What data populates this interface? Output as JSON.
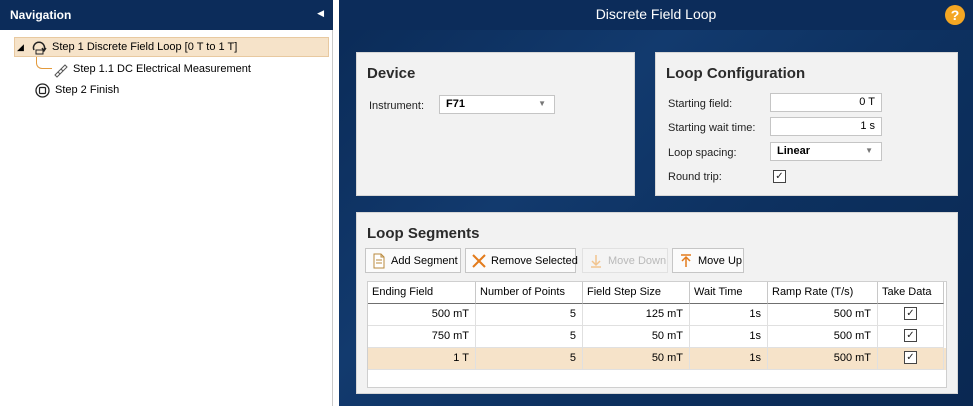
{
  "nav": {
    "title": "Navigation",
    "collapse_icon": "triangle-left-icon",
    "items": [
      {
        "label": "Step 1 Discrete Field Loop [0 T to 1 T]",
        "icon": "loop-icon",
        "expanded": true,
        "selected": true
      },
      {
        "label": "Step 1.1 DC Electrical Measurement",
        "icon": "probe-icon"
      },
      {
        "label": "Step 2 Finish",
        "icon": "finish-icon"
      }
    ]
  },
  "header": {
    "title": "Discrete Field Loop",
    "help_label": "?"
  },
  "device": {
    "title": "Device",
    "instrument_label": "Instrument:",
    "instrument_value": "F71"
  },
  "loop_config": {
    "title": "Loop Configuration",
    "starting_field_label": "Starting field:",
    "starting_field_value": "0 T",
    "starting_wait_label": "Starting wait time:",
    "starting_wait_value": "1 s",
    "spacing_label": "Loop spacing:",
    "spacing_value": "Linear",
    "round_trip_label": "Round trip:",
    "round_trip_checked": true,
    "check_glyph": "✓"
  },
  "segments": {
    "title": "Loop Segments",
    "buttons": {
      "add": "Add Segment",
      "remove": "Remove Selected",
      "move_down": "Move Down",
      "move_up": "Move Up"
    },
    "columns": [
      "Ending Field",
      "Number of Points",
      "Field Step Size",
      "Wait Time",
      "Ramp Rate (T/s)",
      "Take Data"
    ],
    "rows": [
      {
        "ending_field": "500 mT",
        "points": "5",
        "step": "125 mT",
        "wait": "1s",
        "ramp": "500 mT",
        "take_data": true
      },
      {
        "ending_field": "750 mT",
        "points": "5",
        "step": "50 mT",
        "wait": "1s",
        "ramp": "500 mT",
        "take_data": true
      },
      {
        "ending_field": "1 T",
        "points": "5",
        "step": "50 mT",
        "wait": "1s",
        "ramp": "500 mT",
        "take_data": true
      }
    ]
  },
  "colors": {
    "header_bg": "#0c2c5a",
    "selection": "#f6e3c9",
    "accent_orange": "#f4a623",
    "panel_bg": "#f2f2f2"
  }
}
